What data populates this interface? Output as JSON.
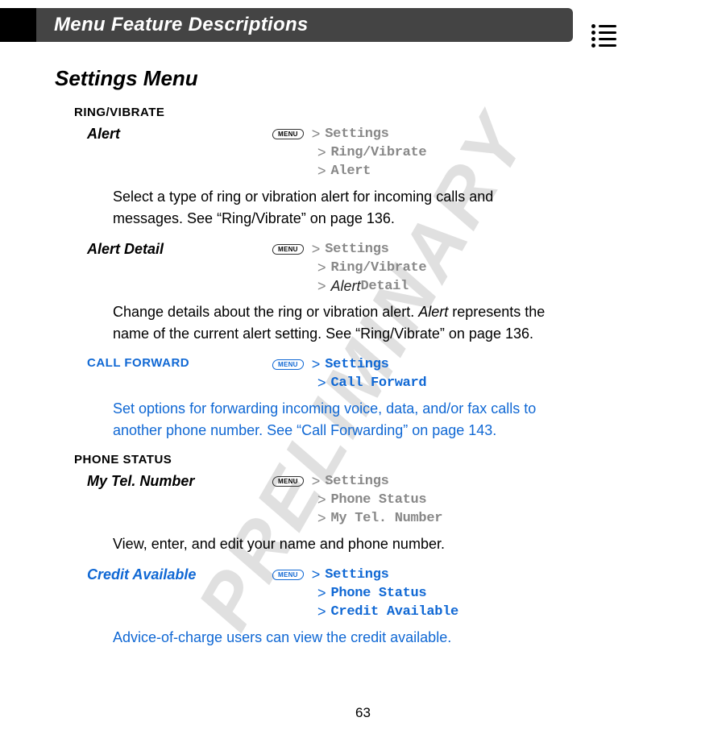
{
  "header": {
    "title": "Menu Feature Descriptions"
  },
  "watermark": "PRELIMINARY",
  "section_title": "Settings Menu",
  "menu_key": "MENU",
  "subheads": {
    "ring_vibrate": "RING/VIBRATE",
    "phone_status": "PHONE STATUS"
  },
  "entries": {
    "alert": {
      "name": "Alert",
      "path": [
        "Settings",
        "Ring/Vibrate",
        "Alert"
      ],
      "desc": "Select a type of ring or vibration alert for incoming calls and messages. See “Ring/Vibrate” on page 136."
    },
    "alert_detail": {
      "name": "Alert Detail",
      "path_prefix": [
        "Settings",
        "Ring/Vibrate"
      ],
      "path_italic": "Alert",
      "path_suffix": " Detail",
      "desc_a": "Change details about the ring or vibration alert. ",
      "desc_b": "Alert",
      "desc_c": " represents the name of the current alert setting. See “Ring/Vibrate” on page 136."
    },
    "call_forward": {
      "name": "CALL FORWARD",
      "path": [
        "Settings",
        "Call Forward"
      ],
      "desc": "Set options for forwarding incoming voice, data, and/or fax calls to another phone number. See “Call Forwarding” on page 143."
    },
    "my_tel": {
      "name": "My Tel. Number",
      "path": [
        "Settings",
        "Phone Status",
        "My Tel. Number"
      ],
      "desc": "View, enter, and edit your name and phone number."
    },
    "credit": {
      "name": "Credit Available",
      "path": [
        "Settings",
        "Phone Status",
        "Credit Available"
      ],
      "desc": "Advice-of-charge users can view the credit available."
    }
  },
  "page_number": "63"
}
